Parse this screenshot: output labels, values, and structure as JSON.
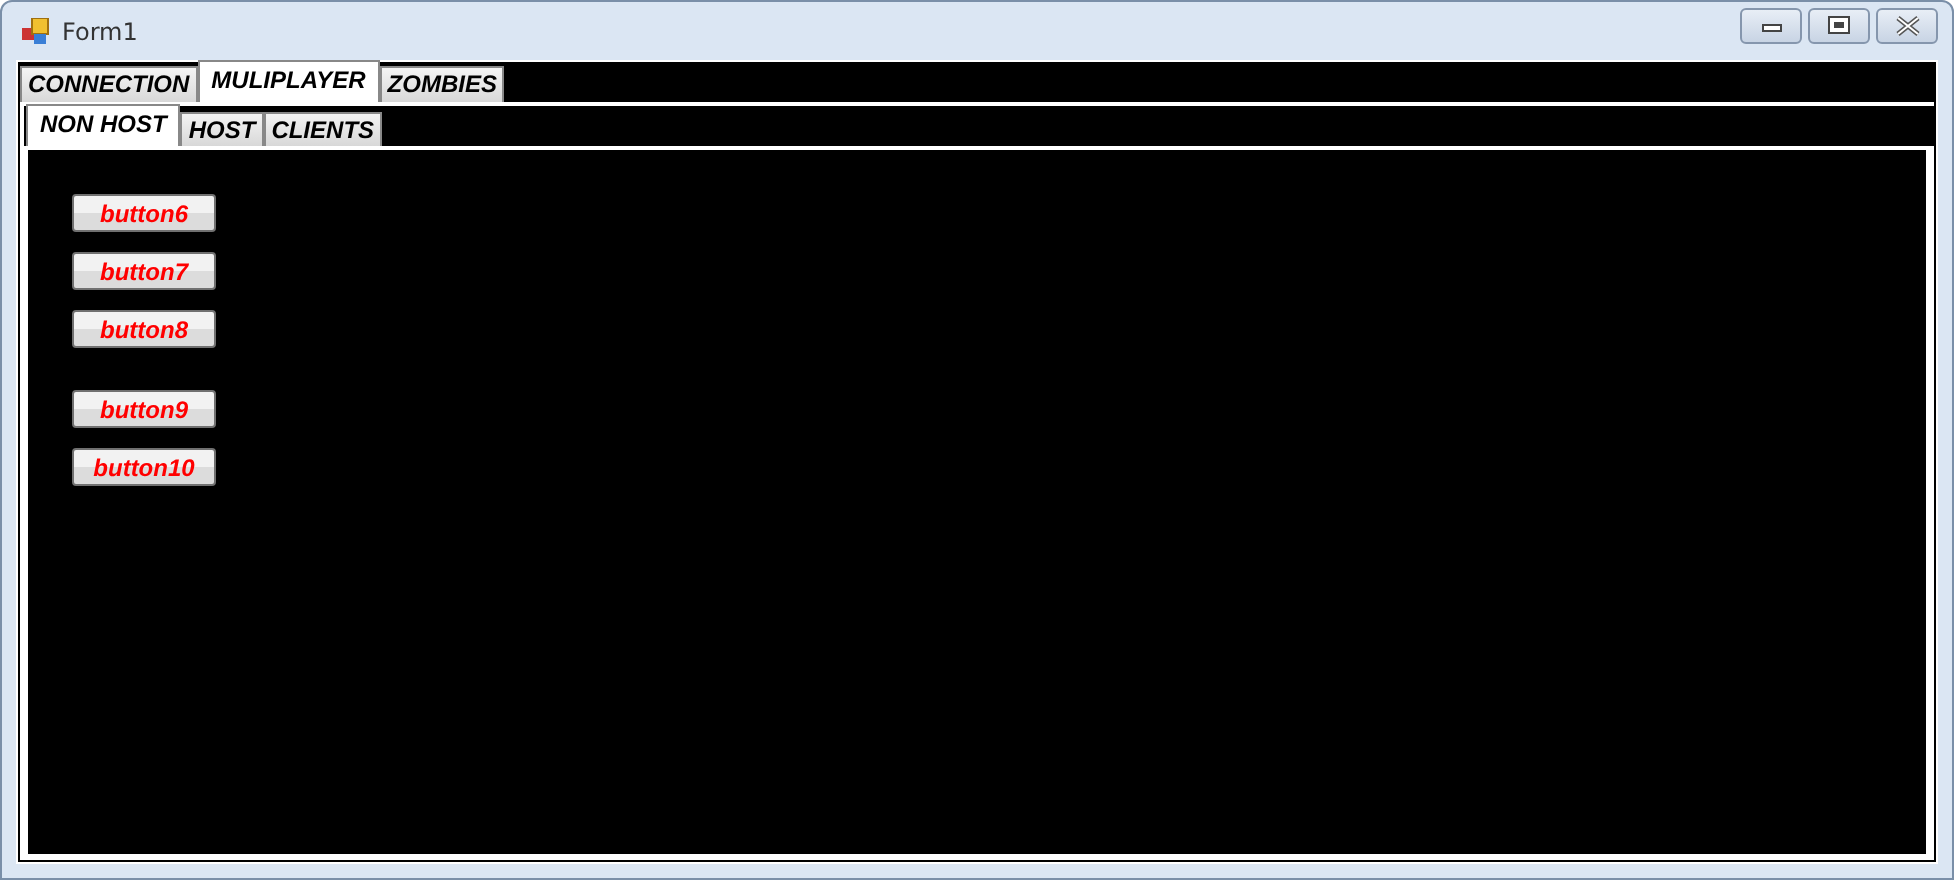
{
  "window": {
    "title": "Form1"
  },
  "tabs": [
    {
      "label": "CONNECTION",
      "selected": false
    },
    {
      "label": "MULIPLAYER",
      "selected": true
    },
    {
      "label": "ZOMBIES",
      "selected": false
    }
  ],
  "subtabs": [
    {
      "label": "NON HOST",
      "selected": true
    },
    {
      "label": "HOST",
      "selected": false
    },
    {
      "label": "CLIENTS",
      "selected": false
    }
  ],
  "button_groups": [
    [
      "button6",
      "button7",
      "button8"
    ],
    [
      "button9",
      "button10"
    ]
  ]
}
